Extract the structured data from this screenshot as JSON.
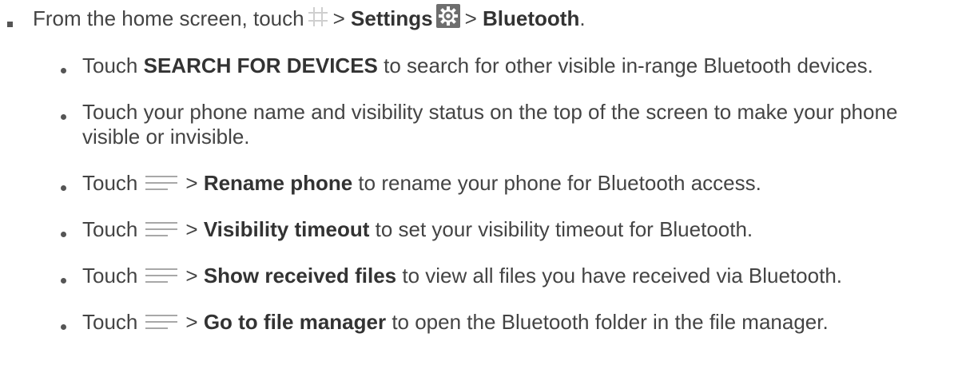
{
  "intro": {
    "prefix": "From the home screen, touch",
    "sep1": ">",
    "settings": "Settings",
    "sep2": ">",
    "bluetooth": "Bluetooth",
    "end": "."
  },
  "items": [
    {
      "prefix": "Touch",
      "bold": "SEARCH FOR DEVICES",
      "suffix": "to search for other visible in-range Bluetooth devices."
    },
    {
      "line1": "Touch your phone name and visibility status on the top of the screen to make your phone",
      "line2": "visible or invisible."
    },
    {
      "prefix": "Touch",
      "sep": ">",
      "bold": "Rename phone",
      "suffix": "to rename your phone for Bluetooth access."
    },
    {
      "prefix": "Touch",
      "sep": ">",
      "bold": "Visibility timeout",
      "suffix": "to set your visibility timeout for Bluetooth."
    },
    {
      "prefix": "Touch",
      "sep": ">",
      "bold": "Show received files",
      "suffix": "to view all files you have received via Bluetooth."
    },
    {
      "prefix": "Touch",
      "sep": ">",
      "bold": "Go to file manager",
      "suffix": "to open the Bluetooth folder in the file manager."
    }
  ],
  "icons": {
    "apps": "grid-icon",
    "settings": "gear-icon",
    "menu": "menu-icon"
  },
  "colors": {
    "text": "#444444",
    "bold": "#333333",
    "grid_icon": "#cfcfcf",
    "gear_bg": "#6e6e6e",
    "menu_icon": "#a8a8a8"
  }
}
